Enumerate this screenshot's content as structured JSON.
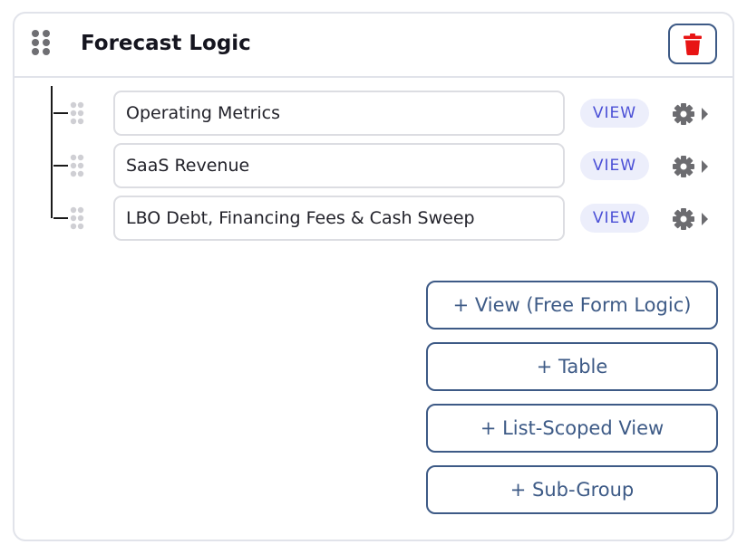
{
  "group": {
    "title": "Forecast Logic",
    "delete_icon": "trash-icon",
    "colors": {
      "delete": "#e81414",
      "accent": "#3d5a86",
      "view_text": "#4b50d6",
      "view_bg": "#eceefb"
    }
  },
  "items": [
    {
      "name": "Operating Metrics",
      "view_label": "VIEW"
    },
    {
      "name": "SaaS Revenue",
      "view_label": "VIEW"
    },
    {
      "name": "LBO Debt, Financing Fees & Cash Sweep",
      "view_label": "VIEW"
    }
  ],
  "actions": {
    "add_view": "+ View (Free Form Logic)",
    "add_table": "+ Table",
    "add_list_scoped_view": "+ List-Scoped View",
    "add_sub_group": "+ Sub-Group"
  }
}
